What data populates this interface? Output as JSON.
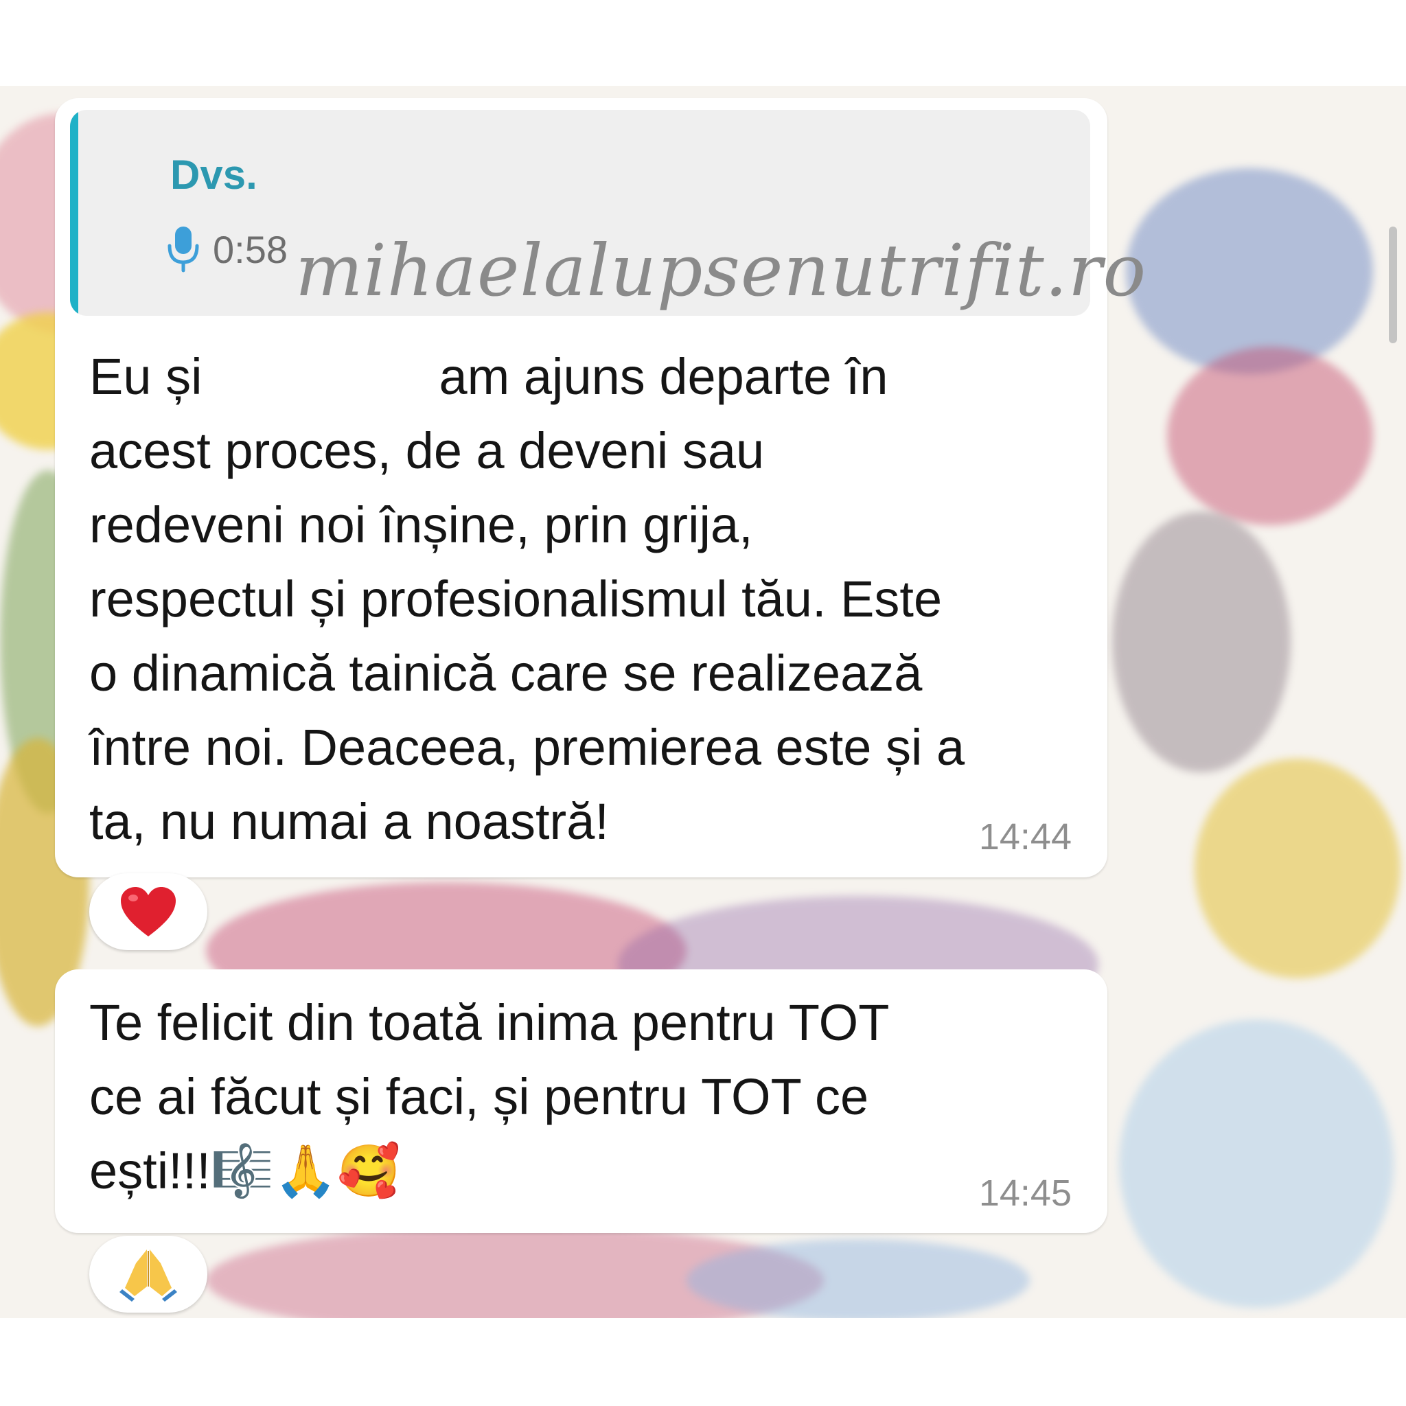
{
  "watermark": "mihaelalupsenutrifit.ro",
  "colors": {
    "quote_bar": "#1fb1c7",
    "quote_author": "#2c98b0",
    "heart": "#e0202f",
    "bubble_bg": "#ffffff",
    "quote_bg": "#efefef"
  },
  "messages": [
    {
      "quoted_reply": {
        "author": "Dvs.",
        "type_icon": "microphone-icon",
        "duration": "0:58"
      },
      "lines": [
        {
          "before": "Eu și",
          "after": "am ajuns departe în"
        },
        "acest proces, de a deveni sau",
        "redeveni noi înșine, prin grija,",
        "respectul și profesionalismul tău. Este",
        "o dinamică tainică care se realizează",
        "între noi. Deaceea, premierea este și a",
        "ta, nu numai a noastră!"
      ],
      "time": "14:44",
      "reaction": {
        "icon": "red-heart-icon",
        "glyph": "❤️"
      }
    },
    {
      "lines": [
        "Te felicit din toată inima pentru TOT",
        "ce ai făcut și faci, și pentru TOT ce",
        "ești!!!🎼🙏🥰"
      ],
      "time": "14:45",
      "reaction": {
        "icon": "folded-hands-icon",
        "glyph": "🙏"
      }
    }
  ]
}
